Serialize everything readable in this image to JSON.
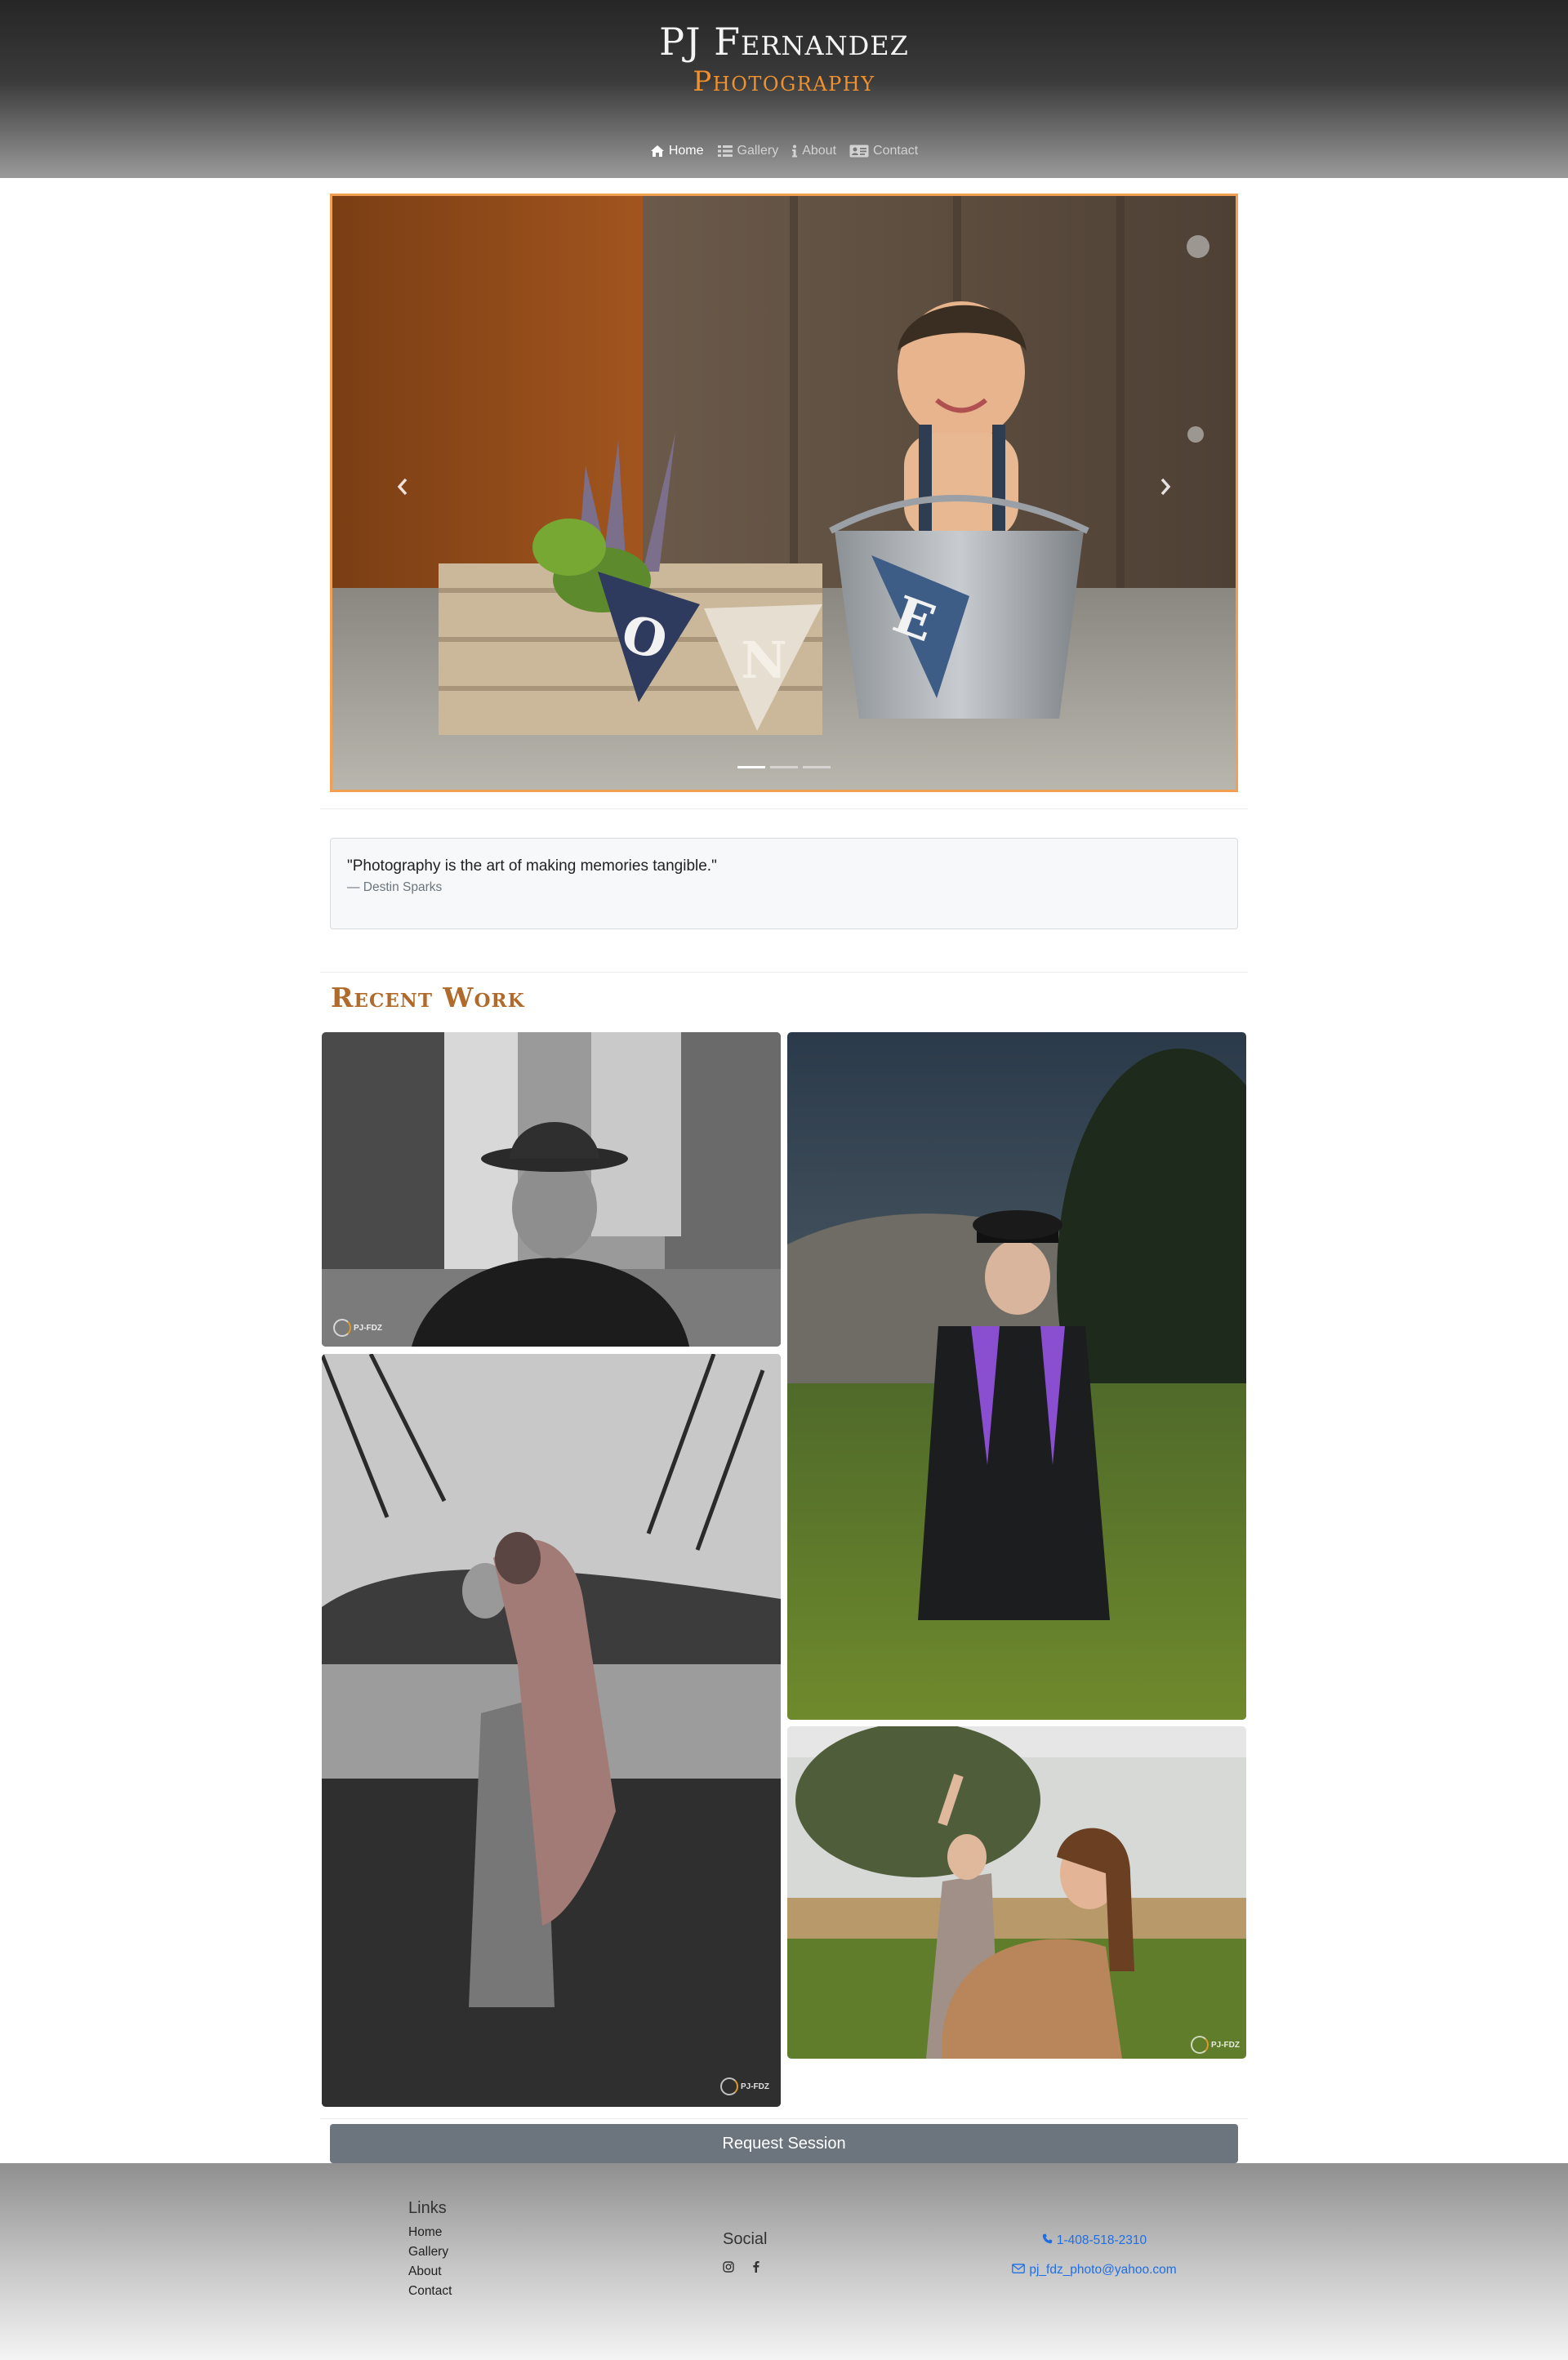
{
  "brand": {
    "name": "PJ Fernandez",
    "tagline": "Photography"
  },
  "nav": {
    "items": [
      {
        "label": "Home",
        "icon": "home-icon",
        "active": true
      },
      {
        "label": "Gallery",
        "icon": "list-icon",
        "active": false
      },
      {
        "label": "About",
        "icon": "info-icon",
        "active": false
      },
      {
        "label": "Contact",
        "icon": "contact-card-icon",
        "active": false
      }
    ]
  },
  "carousel": {
    "slide_count": 3,
    "active_slide": 1,
    "accent_border": "#f0a050",
    "letters": [
      "O",
      "N",
      "E"
    ]
  },
  "quote": {
    "text": "\"Photography is the art of making memories tangible.\"",
    "author": "— Destin Sparks"
  },
  "recent_work": {
    "title": "Recent Work",
    "watermark": "PJ-FDZ"
  },
  "cta": {
    "label": "Request Session"
  },
  "footer": {
    "links_heading": "Links",
    "links": [
      "Home",
      "Gallery",
      "About",
      "Contact"
    ],
    "social_heading": "Social",
    "social_icons": [
      "instagram-icon",
      "facebook-icon"
    ],
    "phone": "1-408-518-2310",
    "email": "pj_fdz_photo@yahoo.com"
  },
  "colors": {
    "accent_orange": "#f0912e",
    "title_brown": "#b06a2c",
    "link_blue": "#1e6fe6",
    "button_gray": "#6c757d"
  }
}
